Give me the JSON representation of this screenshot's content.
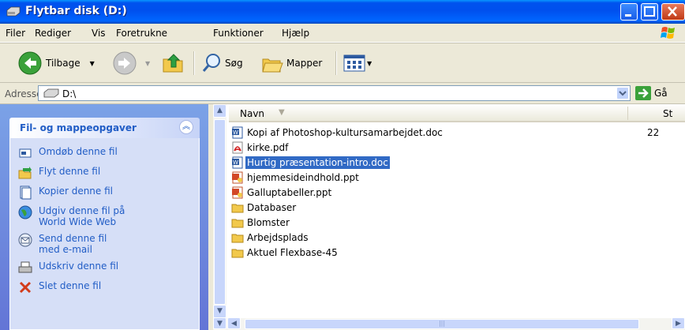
{
  "window": {
    "title": "Flytbar disk (D:)"
  },
  "menu": [
    "Filer",
    "Rediger",
    "Vis",
    "Foretrukne",
    "Funktioner",
    "Hjælp"
  ],
  "toolbar": {
    "back": "Tilbage",
    "search": "Søg",
    "folders": "Mapper"
  },
  "address": {
    "label": "Adresse",
    "value": "D:\\",
    "go": "Gå"
  },
  "tasks": {
    "title": "Fil- og mappeopgaver",
    "items": [
      {
        "label": "Omdøb denne fil",
        "icon": "rename-icon"
      },
      {
        "label": "Flyt denne fil",
        "icon": "move-icon"
      },
      {
        "label": "Kopier denne fil",
        "icon": "copy-icon"
      },
      {
        "label": "Udgiv denne fil på World Wide Web",
        "icon": "publish-web-icon"
      },
      {
        "label": "Send denne fil med e-mail",
        "icon": "email-icon"
      },
      {
        "label": "Udskriv denne fil",
        "icon": "print-icon"
      },
      {
        "label": "Slet denne fil",
        "icon": "delete-icon"
      }
    ]
  },
  "list": {
    "columns": {
      "name": "Navn",
      "size": "St"
    },
    "files": [
      {
        "name": "Kopi af Photoshop-kultursamarbejdet.doc",
        "type": "doc",
        "size": "22"
      },
      {
        "name": "kirke.pdf",
        "type": "pdf",
        "size": ""
      },
      {
        "name": "Hurtig præsentation-intro.doc",
        "type": "doc",
        "size": "",
        "selected": true
      },
      {
        "name": "hjemmesideindhold.ppt",
        "type": "ppt",
        "size": ""
      },
      {
        "name": "Galluptabeller.ppt",
        "type": "ppt",
        "size": ""
      },
      {
        "name": "Databaser",
        "type": "folder",
        "size": ""
      },
      {
        "name": "Blomster",
        "type": "folder",
        "size": ""
      },
      {
        "name": "Arbejdsplads",
        "type": "folder",
        "size": ""
      },
      {
        "name": "Aktuel Flexbase-45",
        "type": "folder",
        "size": ""
      }
    ]
  }
}
